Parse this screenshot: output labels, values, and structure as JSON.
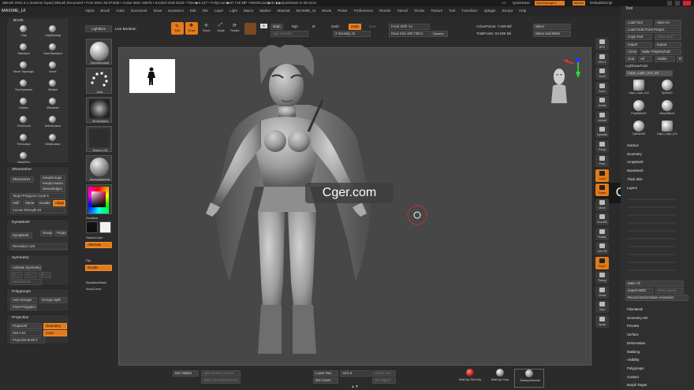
{
  "title_bar": {
    "text": "ZBrush 2021.5.1 [maxime loyan]   ZBrush Document   • Free Mem 36.973GB • Active Mem 15575 • Scratch Disk 8126 • Timer▶0.127 • PolyCount▶87.716 MP • MeshCount▶32 ▶▶QuickSave In 59 Secs",
    "ac": "AC",
    "quicksave": "QuickSave",
    "see_through": "See-through  0",
    "menus": "Menus",
    "default_zscript": "DefaultZScript"
  },
  "menu_bar": {
    "left_label": "MAXIME_UI",
    "items": [
      "Alpha",
      "Brush",
      "Color",
      "Document",
      "Draw",
      "Dynamics",
      "Edit",
      "File",
      "Layer",
      "Light",
      "Macro",
      "Marker",
      "Material",
      "MAXIME_UI",
      "Movie",
      "Picker",
      "Preferences",
      "Render",
      "Stencil",
      "Stroke",
      "Texture",
      "Tool",
      "Transform",
      "Zplugin",
      "Zscript",
      "Help"
    ]
  },
  "left_panel": {
    "brush_header": "Brush",
    "brushes": [
      "Clay",
      "ClayBuildup",
      "Standard",
      "DamStandard",
      "Move Topologic",
      "Move",
      "TrimDynamic",
      "hPolish",
      "Flatten",
      "ZModeler",
      "TrimCurve",
      "SelectLasso",
      "TrimLasso",
      "MaskLasso",
      "MaskPen"
    ],
    "zremesher": {
      "title": "ZRemesher",
      "zremesher_btn": "ZRemesher",
      "keep_groups": "KeepGroups",
      "keep_creases": "KeepCreases",
      "detect_edges": "DetectEdges",
      "target_polycount": "Target Polygons Count 5",
      "half": "Half",
      "same": "Same",
      "double": "Double",
      "adapt": "Adapt",
      "curves_strength": "Curves Strength 50"
    },
    "dynamesh": {
      "title": "DynaMesh",
      "dynamesh_btn": "DynaMesh",
      "groups": "Groups",
      "project": "Project",
      "resolution": "Resolution 128"
    },
    "symmetry": {
      "title": "Symmetry",
      "activate": "Activate Symmetry",
      "x": "X",
      "y": "Y",
      "z": "Z",
      "radial": "RadialCount"
    },
    "polygroups": {
      "title": "Polygroups",
      "auto_groups": "Auto Groups",
      "groups_split": "Groups Split",
      "from_polypaint": "From Polypaint"
    },
    "projection": {
      "title": "Projection",
      "project_all": "ProjectAll",
      "geometry": "Geometry",
      "dist": "Dist 0.02",
      "color": "Color",
      "projection_shell": "ProjectionShell 0"
    }
  },
  "second_panel": {
    "lightbox": "LightBox",
    "live_boolean": "Live Boolean",
    "brush_name": "DamStandard",
    "stroke": "Dots",
    "alpha": "~BrushAlpha",
    "texture": "Texture Off",
    "material": "StartupMaterial",
    "gradient": "Gradient",
    "switch_color": "SwitchColor",
    "alternate": "Alternate",
    "flip": "Flip",
    "double": "Double",
    "backface_mask": "BackfaceMask",
    "accucurve": "AccuCurve"
  },
  "top_shelf": {
    "edit": "Edit",
    "draw": "Draw",
    "move": "Move",
    "scale": "Scale",
    "rotate": "Rotate",
    "a_label": "A",
    "mrgb": "Mrgb",
    "rgb": "Rgb",
    "m": "M",
    "zadd": "Zadd",
    "zsub": "Zsub",
    "zcut": "Zcut",
    "rgb_intensity": "Rgb Intensity",
    "z_intensity": "Z Intensity 33",
    "focal_shift": "Focal Shift -14",
    "draw_size": "Draw Size 300.73513",
    "dynamic": "Dynamic",
    "active_points": "ActivePoints: 7.929 Mil",
    "total_points": "TotalPoints: 53.699 Mil",
    "mirror": "Mirror",
    "mirror_weld": "Mirror And Weld"
  },
  "right_toolbar": {
    "items": [
      "BPR",
      "SPix 3",
      "Scroll",
      "Zoom",
      "Actual",
      "AAHalf",
      "Dynamic",
      "Persp",
      "Floor",
      "Local",
      "Frame",
      "Move",
      "Zoom3D",
      "Rotate",
      "Line Fill",
      "PolyF",
      "Transp",
      "Ghost",
      "Solo",
      "Xpose"
    ]
  },
  "tool_panel": {
    "title": "Tool",
    "load_tool": "Load Tool",
    "save_as": "Save As",
    "load_from_project": "Load Tools From Project",
    "copy_tool": "Copy Tool",
    "paste_tool": "Paste Tool",
    "import": "Import",
    "export": "Export",
    "clone": "Clone",
    "make_polymesh": "Make PolyMesh3D",
    "goz": "GoZ",
    "all": "All",
    "visible": "Visible",
    "r": "R",
    "lightbox_tools": "Lightbox▸Tools",
    "current_tool": "Cape_Lupin_012_48",
    "count": "48",
    "thumbs": [
      "Cape_Lupin_012",
      "SphereD",
      "PolyMesh3D",
      "SimpleBrush",
      "Cylinder3D",
      "Cape_Lupin_012"
    ],
    "subtools": [
      "Subtool",
      "Geometry",
      "ArrayMesh",
      "NanoMesh",
      "Thick Skin",
      "Layers"
    ],
    "bake_all": "Bake All",
    "import_mdd": "Import MDD",
    "mdd_speed": "MDD Speed",
    "record_deformation": "Record Deformation Animation",
    "sections": [
      "FiberMesh",
      "Geometry HD",
      "Preview",
      "Surface",
      "Deformation",
      "Masking",
      "Visibility",
      "Polygroups",
      "Contact",
      "Morph Target"
    ]
  },
  "bottom_shelf": {
    "del_hidden": "Del Hidden",
    "split_masked": "Split Masked Points",
    "split_unmasked": "Split Unmasked Points",
    "lower_res": "Lower Res",
    "sdiv": "SDiv 8",
    "higher_res": "Higher Res",
    "del_lower": "Del Lower",
    "del_higher": "Del Higher",
    "mat1": "MatCap Red Wa",
    "mat2": "MatCap Gray",
    "mat3": "StartupMaterial"
  },
  "watermarks": [
    "Cger.com",
    "Cger.com"
  ],
  "colors": {
    "accent": "#e47a1a",
    "canvas": "#474747",
    "bg": "#2b2b2b"
  }
}
